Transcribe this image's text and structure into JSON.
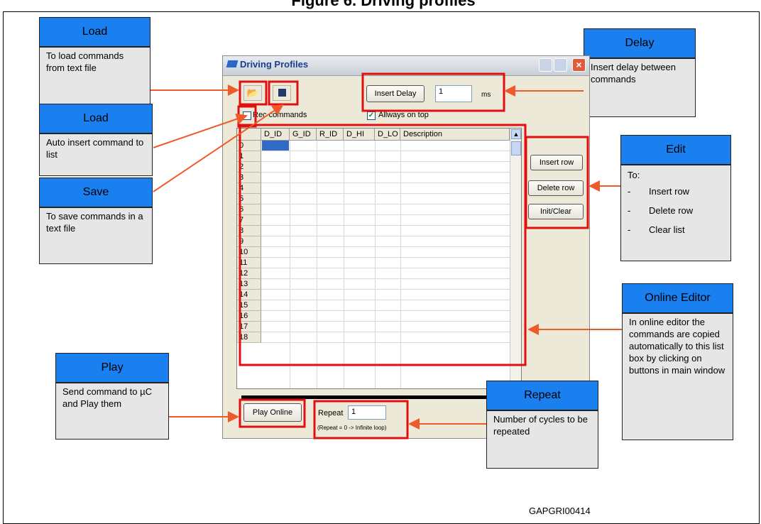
{
  "figure": {
    "top_caption": "Figure 6. Driving profiles",
    "code": "GAPGRI00414"
  },
  "window": {
    "title": "Driving Profiles",
    "toolbar": {
      "insert_delay_label": "Insert Delay",
      "delay_value": "1",
      "delay_unit": "ms",
      "rec_commands_label": "Rec commands",
      "rec_commands_checked": false,
      "always_on_top_label": "Allways on top",
      "always_on_top_checked": true
    },
    "grid": {
      "columns": [
        "D_ID",
        "G_ID",
        "R_ID",
        "D_HI",
        "D_LO",
        "Description"
      ],
      "rows": [
        "0",
        "1",
        "2",
        "3",
        "4",
        "5",
        "6",
        "7",
        "8",
        "9",
        "10",
        "11",
        "12",
        "13",
        "14",
        "15",
        "16",
        "17",
        "18"
      ],
      "selected_row": 0,
      "selected_column": "D_ID"
    },
    "side_buttons": {
      "insert_row": "Insert row",
      "delete_row": "Delete row",
      "init_clear": "Init/Clear"
    },
    "bottom": {
      "play_online": "Play Online",
      "repeat_label": "Repeat",
      "repeat_value": "1",
      "repeat_hint": "(Repeat = 0 -> Infinite loop)"
    }
  },
  "callouts": {
    "load1": {
      "title": "Load",
      "text": "To load commands from text file"
    },
    "load2": {
      "title": "Load",
      "text": "Auto insert command to list"
    },
    "save": {
      "title": "Save",
      "text": "To save commands in a text file"
    },
    "play": {
      "title": "Play",
      "text": "Send command to µC and Play them"
    },
    "delay": {
      "title": "Delay",
      "text": "Insert delay between commands"
    },
    "edit": {
      "title": "Edit",
      "intro": "To:",
      "items": [
        "Insert row",
        "Delete row",
        "Clear list"
      ]
    },
    "online_editor": {
      "title": "Online Editor",
      "text": "In online editor the commands are copied automatically to this list box by clicking on buttons in main window"
    },
    "repeat": {
      "title": "Repeat",
      "text": "Number of cycles to be repeated"
    }
  },
  "colors": {
    "callout_header": "#1a7fef",
    "callout_body": "#e6e6e6",
    "highlight_red": "#e01010",
    "arrow": "#f05a28",
    "selection": "#316ac5"
  }
}
